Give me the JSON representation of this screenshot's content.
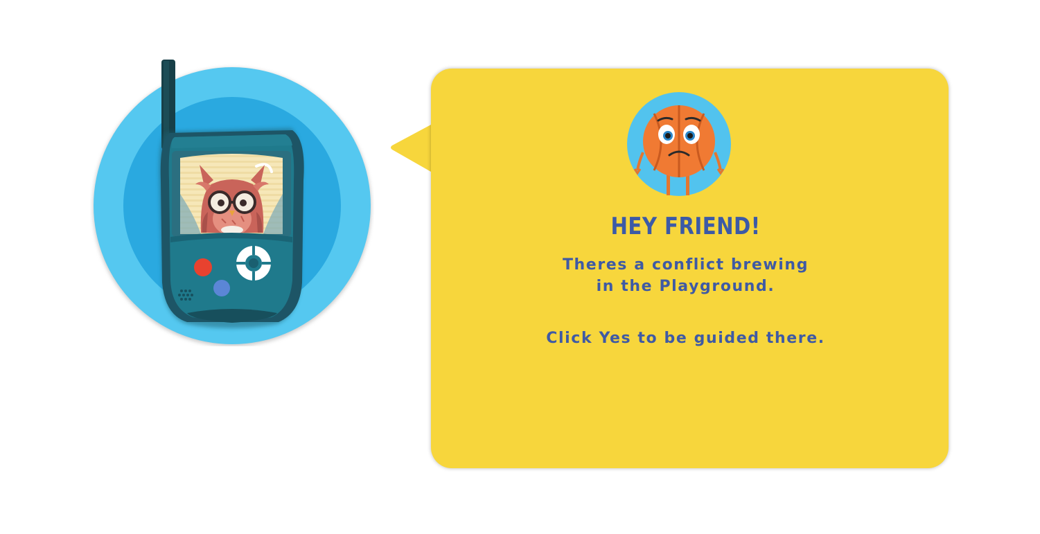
{
  "dialog": {
    "title": "HEY FRIEND!",
    "message_line1": "Theres a conflict brewing",
    "message_line2": "in the Playground.",
    "instruction": "Click Yes to be guided there."
  },
  "colors": {
    "bubble": "#f7d63c",
    "text": "#3f5aa4",
    "badge_outer": "#55c8f0",
    "badge_inner": "#2aa9e0",
    "device": "#1e7688",
    "ball": "#f07a33"
  },
  "icons": {
    "badge": "walkie-talkie-icon",
    "character": "basketball-character-icon"
  }
}
